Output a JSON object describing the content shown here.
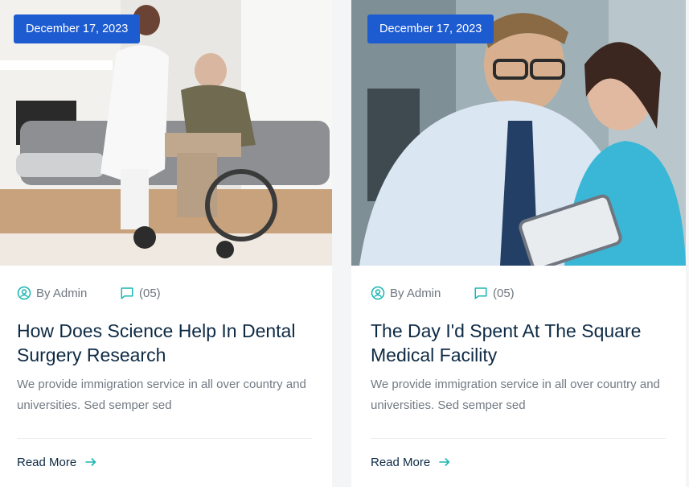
{
  "posts": [
    {
      "date": "December 17, 2023",
      "author": "By Admin",
      "comments": "(05)",
      "title": "How Does Science Help In Dental Surgery Research",
      "excerpt": "We provide immigration service in all over country and universities. Sed semper sed",
      "read_more": "Read More"
    },
    {
      "date": "December 17, 2023",
      "author": "By Admin",
      "comments": "(05)",
      "title": "The Day I'd Spent At The Square Medical Facility",
      "excerpt": "We provide immigration service in all over country and universities. Sed semper sed",
      "read_more": "Read More"
    }
  ],
  "colors": {
    "badge": "#1d5bd1",
    "title": "#0d2a44",
    "text": "#727a83",
    "accent": "#19b5b0"
  },
  "icons": {
    "author": "user-circle-icon",
    "comments": "chat-bubble-icon",
    "read_more": "arrow-right-icon"
  }
}
